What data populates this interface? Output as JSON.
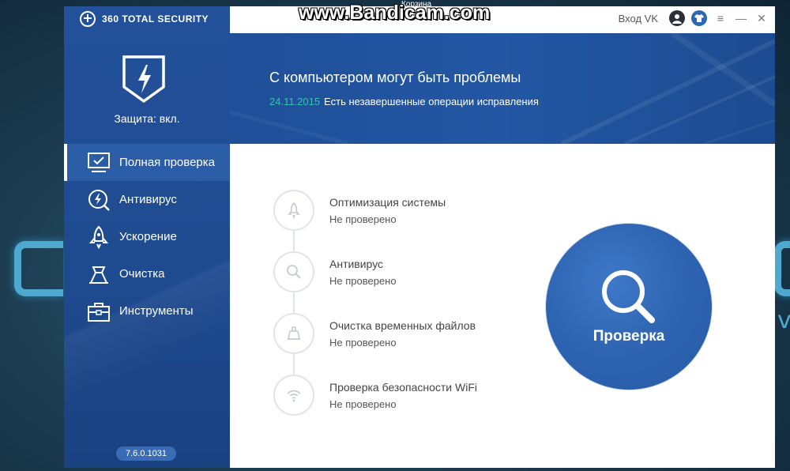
{
  "overlay": {
    "watermark": "www.Bandicam.com",
    "desktop_label": "Корзина"
  },
  "app": {
    "brand": "360 TOTAL SECURITY",
    "protection_status": "Защита: вкл.",
    "version": "7.6.0.1031"
  },
  "topbar": {
    "login_label": "Вход VK",
    "icons": [
      "user-icon",
      "shirt-icon",
      "menu-icon",
      "minimize-icon",
      "close-icon"
    ]
  },
  "sidebar": {
    "items": [
      {
        "label": "Полная проверка",
        "icon": "monitor-check-icon",
        "active": true
      },
      {
        "label": "Антивирус",
        "icon": "bolt-circle-icon",
        "active": false
      },
      {
        "label": "Ускорение",
        "icon": "rocket-icon",
        "active": false
      },
      {
        "label": "Очистка",
        "icon": "broom-icon",
        "active": false
      },
      {
        "label": "Инструменты",
        "icon": "toolbox-icon",
        "active": false
      }
    ]
  },
  "banner": {
    "title": "С компьютером могут быть проблемы",
    "date": "24.11.2015",
    "message": "Есть незавершенные операции исправления"
  },
  "checks": [
    {
      "title": "Оптимизация системы",
      "status": "Не проверено",
      "icon": "rocket-icon"
    },
    {
      "title": "Антивирус",
      "status": "Не проверено",
      "icon": "search-icon"
    },
    {
      "title": "Очистка временных файлов",
      "status": "Не проверено",
      "icon": "broom-icon"
    },
    {
      "title": "Проверка безопасности WiFi",
      "status": "Не проверено",
      "icon": "wifi-icon"
    }
  ],
  "scan_button": {
    "label": "Проверка",
    "icon": "search-icon"
  },
  "colors": {
    "sidebar": "#23519a",
    "banner": "#2357a3",
    "accent_date": "#35c4b1",
    "scan_button": "#2c62b0"
  }
}
